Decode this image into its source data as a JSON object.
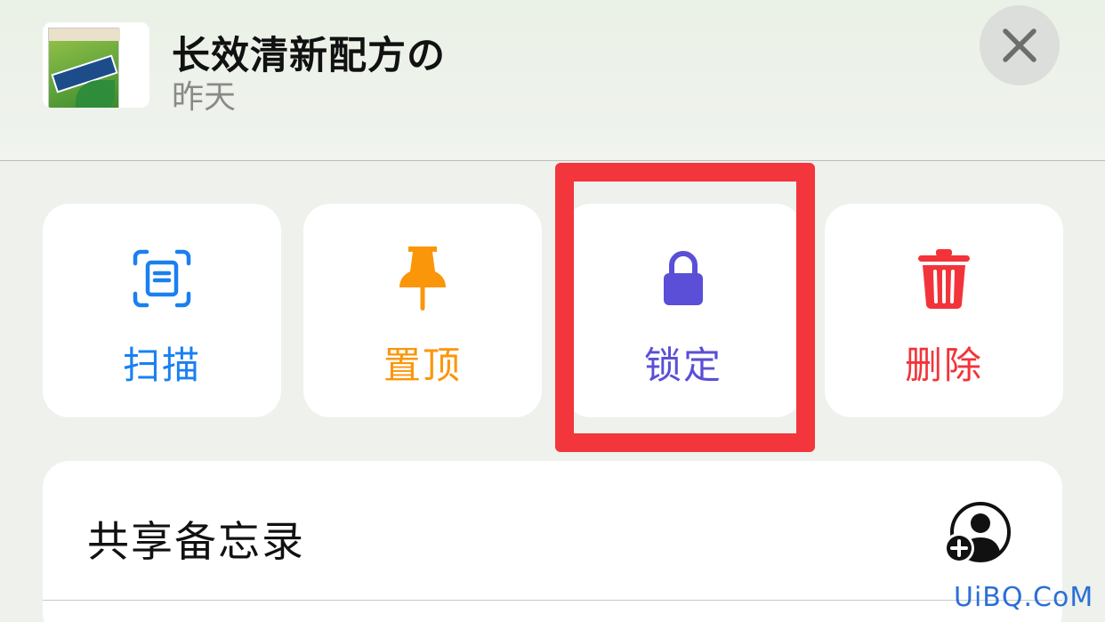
{
  "note": {
    "title": "长效清新配方の",
    "date": "昨天",
    "thumbnail_icon": "note-thumbnail-image"
  },
  "close_icon": "close-icon",
  "actions": [
    {
      "label": "扫描",
      "icon": "scan-document-icon",
      "color": "#1a80f0"
    },
    {
      "label": "置顶",
      "icon": "pin-icon",
      "color": "#fa960a"
    },
    {
      "label": "锁定",
      "icon": "lock-icon",
      "color": "#5a4fd6"
    },
    {
      "label": "删除",
      "icon": "trash-icon",
      "color": "#f2343a"
    }
  ],
  "highlight_color": "#f3363b",
  "share": {
    "label": "共享备忘录",
    "icon": "add-person-icon"
  },
  "watermark": "UiBQ.CoM"
}
